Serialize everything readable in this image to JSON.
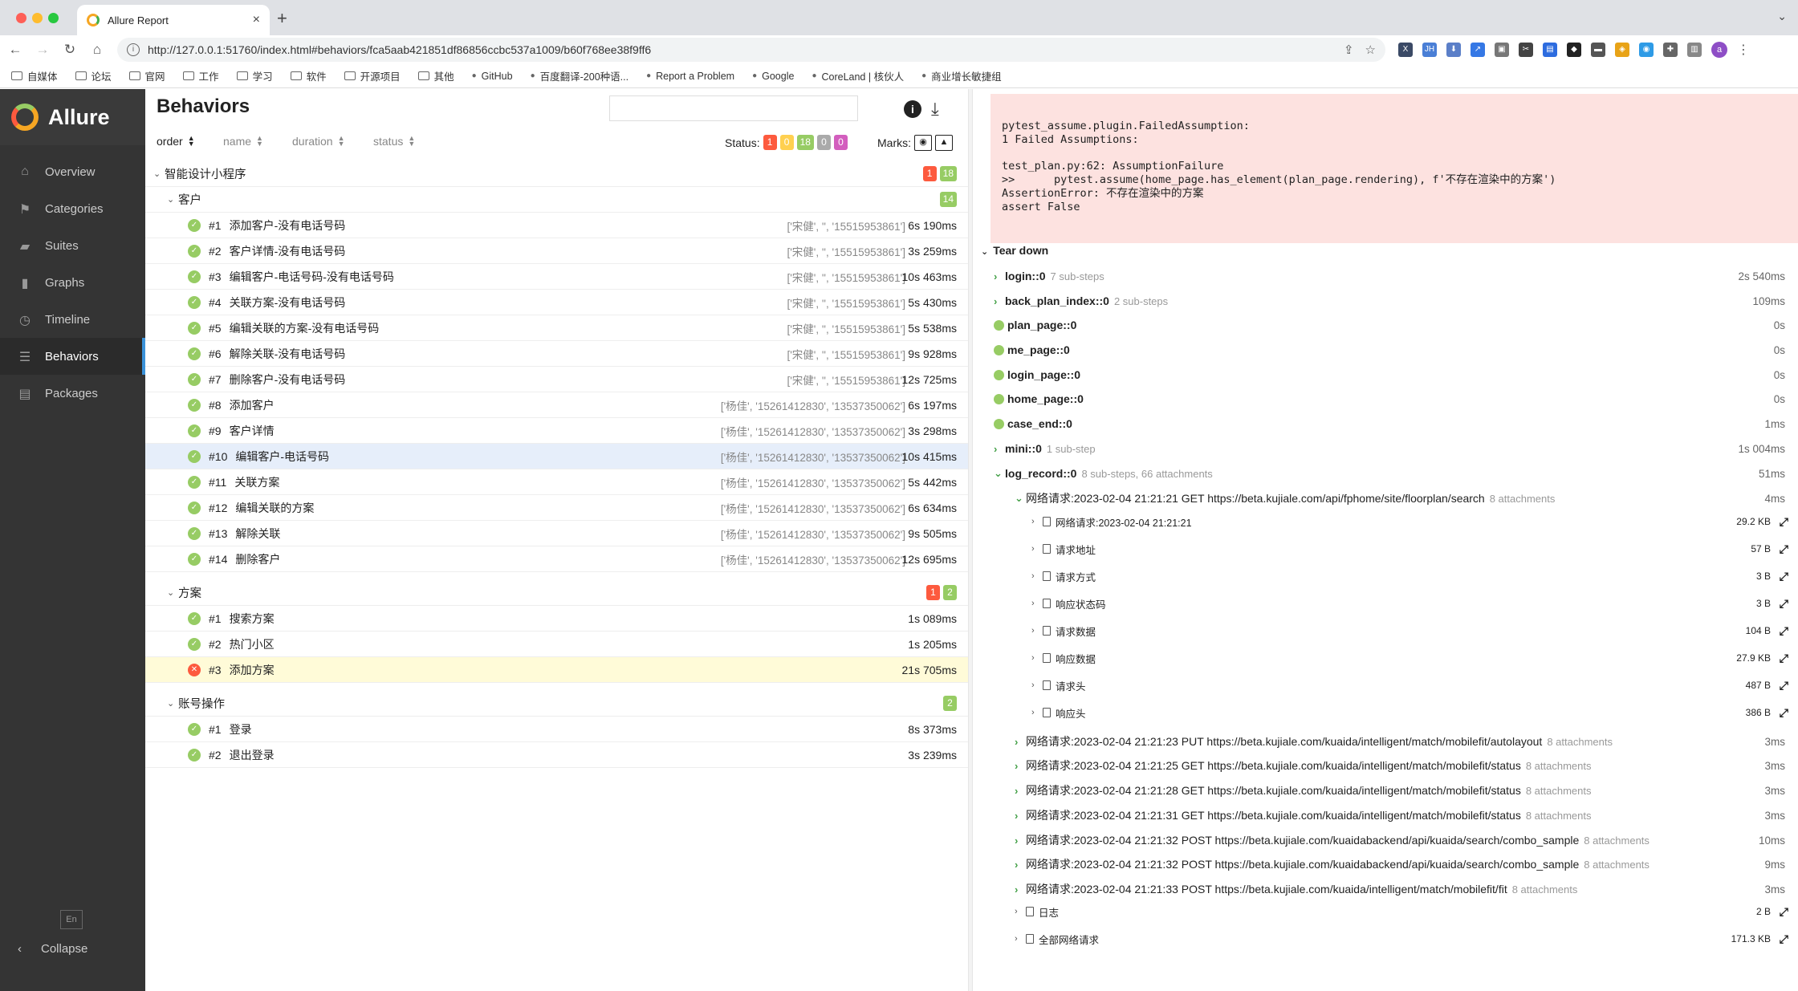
{
  "browser": {
    "tab_title": "Allure Report",
    "url": "http://127.0.0.1:51760/index.html#behaviors/fca5aab421851df86856ccbc537a1009/b60f768ee38f9ff6",
    "bookmarks": [
      "自媒体",
      "论坛",
      "官网",
      "工作",
      "学习",
      "软件",
      "开源项目",
      "其他",
      "GitHub",
      "百度翻译-200种语...",
      "Report a Problem",
      "Google",
      "CoreLand | 核伙人",
      "商业增长敏捷组"
    ]
  },
  "sidebar": {
    "logo": "Allure",
    "items": [
      {
        "label": "Overview",
        "icon": "home-icon"
      },
      {
        "label": "Categories",
        "icon": "flag-icon"
      },
      {
        "label": "Suites",
        "icon": "briefcase-icon"
      },
      {
        "label": "Graphs",
        "icon": "bar-chart-icon"
      },
      {
        "label": "Timeline",
        "icon": "clock-icon"
      },
      {
        "label": "Behaviors",
        "icon": "list-icon"
      },
      {
        "label": "Packages",
        "icon": "stack-icon"
      }
    ],
    "lang": "En",
    "collapse": "Collapse"
  },
  "behaviors": {
    "title": "Behaviors",
    "sort": [
      "order",
      "name",
      "duration",
      "status"
    ],
    "status_label": "Status:",
    "status_counts": [
      "1",
      "0",
      "18",
      "0",
      "0"
    ],
    "marks_label": "Marks:",
    "groups": [
      {
        "name": "智能设计小程序",
        "counts": [
          "1",
          "18"
        ]
      },
      {
        "name": "客户",
        "counts": [
          "14"
        ],
        "rows": [
          {
            "n": "#1",
            "name": "添加客户-没有电话号码",
            "params": "['宋健', '', '15515953861']",
            "dur": "6s 190ms"
          },
          {
            "n": "#2",
            "name": "客户详情-没有电话号码",
            "params": "['宋健', '', '15515953861']",
            "dur": "3s 259ms"
          },
          {
            "n": "#3",
            "name": "编辑客户-电话号码-没有电话号码",
            "params": "['宋健', '', '15515953861']",
            "dur": "10s 463ms"
          },
          {
            "n": "#4",
            "name": "关联方案-没有电话号码",
            "params": "['宋健', '', '15515953861']",
            "dur": "5s 430ms"
          },
          {
            "n": "#5",
            "name": "编辑关联的方案-没有电话号码",
            "params": "['宋健', '', '15515953861']",
            "dur": "5s 538ms"
          },
          {
            "n": "#6",
            "name": "解除关联-没有电话号码",
            "params": "['宋健', '', '15515953861']",
            "dur": "9s 928ms"
          },
          {
            "n": "#7",
            "name": "删除客户-没有电话号码",
            "params": "['宋健', '', '15515953861']",
            "dur": "12s 725ms"
          },
          {
            "n": "#8",
            "name": "添加客户",
            "params": "['杨佳', '15261412830', '13537350062']",
            "dur": "6s 197ms"
          },
          {
            "n": "#9",
            "name": "客户详情",
            "params": "['杨佳', '15261412830', '13537350062']",
            "dur": "3s 298ms"
          },
          {
            "n": "#10",
            "name": "编辑客户-电话号码",
            "params": "['杨佳', '15261412830', '13537350062']",
            "dur": "10s 415ms"
          },
          {
            "n": "#11",
            "name": "关联方案",
            "params": "['杨佳', '15261412830', '13537350062']",
            "dur": "5s 442ms"
          },
          {
            "n": "#12",
            "name": "编辑关联的方案",
            "params": "['杨佳', '15261412830', '13537350062']",
            "dur": "6s 634ms"
          },
          {
            "n": "#13",
            "name": "解除关联",
            "params": "['杨佳', '15261412830', '13537350062']",
            "dur": "9s 505ms"
          },
          {
            "n": "#14",
            "name": "删除客户",
            "params": "['杨佳', '15261412830', '13537350062']",
            "dur": "12s 695ms"
          }
        ]
      },
      {
        "name": "方案",
        "counts": [
          "1",
          "2"
        ],
        "rows": [
          {
            "n": "#1",
            "name": "搜索方案",
            "dur": "1s 089ms"
          },
          {
            "n": "#2",
            "name": "热门小区",
            "dur": "1s 205ms"
          },
          {
            "n": "#3",
            "name": "添加方案",
            "dur": "21s 705ms"
          }
        ]
      },
      {
        "name": "账号操作",
        "counts": [
          "2"
        ],
        "rows": [
          {
            "n": "#1",
            "name": "登录",
            "dur": "8s 373ms"
          },
          {
            "n": "#2",
            "name": "退出登录",
            "dur": "3s 239ms"
          }
        ]
      }
    ]
  },
  "detail": {
    "error_text": "pytest_assume.plugin.FailedAssumption: \n1 Failed Assumptions:\n\ntest_plan.py:62: AssumptionFailure\n>>      pytest.assume(home_page.has_element(plan_page.rendering), f'不存在渲染中的方案')\nAssertionError: 不存在渲染中的方案\nassert False",
    "teardown_title": "Tear down",
    "steps": [
      {
        "name": "login::0",
        "sub": "7 sub-steps",
        "dur": "2s 540ms",
        "kind": "expand"
      },
      {
        "name": "back_plan_index::0",
        "sub": "2 sub-steps",
        "dur": "109ms",
        "kind": "expand"
      },
      {
        "name": "plan_page::0",
        "sub": "",
        "dur": "0s",
        "kind": "ok"
      },
      {
        "name": "me_page::0",
        "sub": "",
        "dur": "0s",
        "kind": "ok"
      },
      {
        "name": "login_page::0",
        "sub": "",
        "dur": "0s",
        "kind": "ok"
      },
      {
        "name": "home_page::0",
        "sub": "",
        "dur": "0s",
        "kind": "ok"
      },
      {
        "name": "case_end::0",
        "sub": "",
        "dur": "1ms",
        "kind": "ok"
      },
      {
        "name": "mini::0",
        "sub": "1 sub-step",
        "dur": "1s 004ms",
        "kind": "expand"
      },
      {
        "name": "log_record::0",
        "sub": "8 sub-steps, 66 attachments",
        "dur": "51ms",
        "kind": "open"
      }
    ],
    "net1": {
      "name": "网络请求:2023-02-04 21:21:21 GET https://beta.kujiale.com/api/fphome/site/floorplan/search",
      "sub": "8 attachments",
      "dur": "4ms"
    },
    "attachments": [
      {
        "name": "网络请求:2023-02-04 21:21:21",
        "size": "29.2 KB"
      },
      {
        "name": "请求地址",
        "size": "57 B"
      },
      {
        "name": "请求方式",
        "size": "3 B"
      },
      {
        "name": "响应状态码",
        "size": "3 B"
      },
      {
        "name": "请求数据",
        "size": "104 B"
      },
      {
        "name": "响应数据",
        "size": "27.9 KB"
      },
      {
        "name": "请求头",
        "size": "487 B"
      },
      {
        "name": "响应头",
        "size": "386 B"
      }
    ],
    "nets": [
      {
        "name": "网络请求:2023-02-04 21:21:23 PUT https://beta.kujiale.com/kuaida/intelligent/match/mobilefit/autolayout",
        "sub": "8 attachments",
        "dur": "3ms"
      },
      {
        "name": "网络请求:2023-02-04 21:21:25 GET https://beta.kujiale.com/kuaida/intelligent/match/mobilefit/status",
        "sub": "8 attachments",
        "dur": "3ms"
      },
      {
        "name": "网络请求:2023-02-04 21:21:28 GET https://beta.kujiale.com/kuaida/intelligent/match/mobilefit/status",
        "sub": "8 attachments",
        "dur": "3ms"
      },
      {
        "name": "网络请求:2023-02-04 21:21:31 GET https://beta.kujiale.com/kuaida/intelligent/match/mobilefit/status",
        "sub": "8 attachments",
        "dur": "3ms"
      },
      {
        "name": "网络请求:2023-02-04 21:21:32 POST https://beta.kujiale.com/kuaidabackend/api/kuaida/search/combo_sample",
        "sub": "8 attachments",
        "dur": "10ms"
      },
      {
        "name": "网络请求:2023-02-04 21:21:32 POST https://beta.kujiale.com/kuaidabackend/api/kuaida/search/combo_sample",
        "sub": "8 attachments",
        "dur": "9ms"
      },
      {
        "name": "网络请求:2023-02-04 21:21:33 POST https://beta.kujiale.com/kuaida/intelligent/match/mobilefit/fit",
        "sub": "8 attachments",
        "dur": "3ms"
      }
    ],
    "bottom_atts": [
      {
        "name": "日志",
        "size": "2 B"
      },
      {
        "name": "全部网络请求",
        "size": "171.3 KB"
      }
    ]
  }
}
